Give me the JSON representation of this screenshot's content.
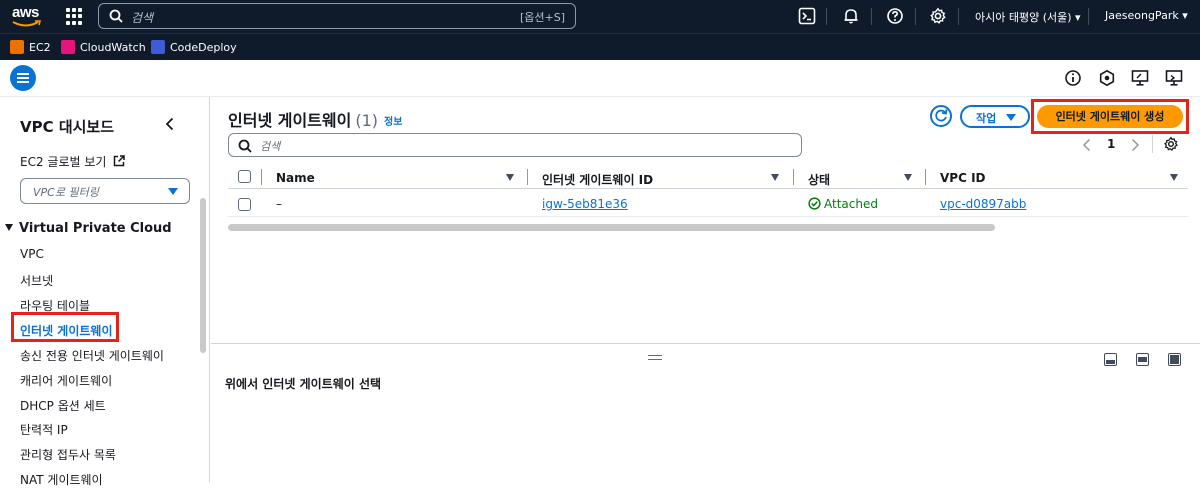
{
  "topnav": {
    "logo": "aws",
    "search_placeholder": "검색",
    "search_shortcut": "[옵션+S]",
    "region": "아시아 태평양 (서울)",
    "user": "JaeseongPark"
  },
  "favorites": [
    {
      "label": "EC2",
      "color": "#ed7100"
    },
    {
      "label": "CloudWatch",
      "color": "#e7157b"
    },
    {
      "label": "CodeDeploy",
      "color": "#3f5bd6"
    }
  ],
  "sidebar": {
    "title": "VPC 대시보드",
    "global_view": "EC2 글로벌 보기",
    "filter_placeholder": "VPC로 필터링",
    "section": "Virtual Private Cloud",
    "items": [
      "VPC",
      "서브넷",
      "라우팅 테이블",
      "인터넷 게이트웨이",
      "송신 전용 인터넷 게이트웨이",
      "캐리어 게이트웨이",
      "DHCP 옵션 세트",
      "탄력적 IP",
      "관리형 접두사 목록",
      "NAT 게이트웨이"
    ],
    "active_index": 3
  },
  "main": {
    "title": "인터넷 게이트웨이",
    "count": "(1)",
    "info": "정보",
    "action_label": "작업",
    "create_label": "인터넷 게이트웨이 생성",
    "search_placeholder": "검색",
    "page": "1",
    "columns": [
      "Name",
      "인터넷 게이트웨이 ID",
      "상태",
      "VPC ID"
    ],
    "rows": [
      {
        "name": "–",
        "id": "igw-5eb81e36",
        "status": "Attached",
        "vpc": "vpc-d0897abb"
      }
    ]
  },
  "split": {
    "title": "위에서 인터넷 게이트웨이 선택"
  },
  "colors": {
    "nav_bg": "#0f1b2a",
    "accent": "#0972d3",
    "primary_button": "#ff9900",
    "success": "#037f0c",
    "highlight": "#e3241b"
  }
}
